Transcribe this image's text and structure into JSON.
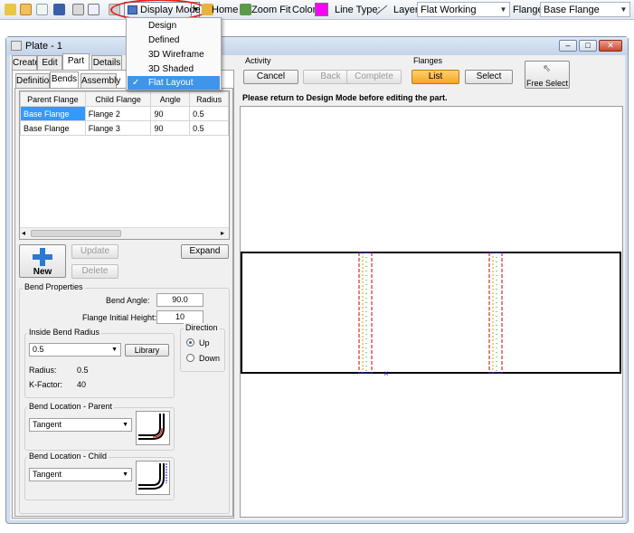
{
  "toolbar": {
    "display_mode_label": "Display Mode",
    "home_label": "Home",
    "zoom_fit_label": "Zoom Fit",
    "color_label": "Color:",
    "color_value": "#ff00ff",
    "line_type_label": "Line Type:",
    "layer_label": "Layer:",
    "layer_value": "Flat Working",
    "flange_label": "Flange:",
    "flange_value": "Base Flange"
  },
  "display_menu": {
    "items": [
      {
        "label": "Design"
      },
      {
        "label": "Defined"
      },
      {
        "label": "3D Wireframe"
      },
      {
        "label": "3D Shaded"
      },
      {
        "label": "Flat Layout",
        "checked": true
      }
    ]
  },
  "window": {
    "title": "Plate - 1",
    "tabs": [
      "Create",
      "Edit",
      "Part",
      "Details"
    ],
    "active_tab": "Part",
    "subtabs": [
      "Definition",
      "Bends",
      "Assembly"
    ],
    "active_subtab": "Bends"
  },
  "bends_table": {
    "headers": [
      "Parent Flange",
      "Child Flange",
      "Angle",
      "Radius"
    ],
    "rows": [
      [
        "Base Flange",
        "Flange 2",
        "90",
        "0.5"
      ],
      [
        "Base Flange",
        "Flange 3",
        "90",
        "0.5"
      ]
    ]
  },
  "buttons": {
    "new": "New",
    "update": "Update",
    "delete": "Delete",
    "expand": "Expand",
    "library": "Library"
  },
  "bend_properties": {
    "group_label": "Bend Properties",
    "bend_angle_label": "Bend Angle:",
    "bend_angle_value": "90.0",
    "flange_height_label": "Flange Initial Height:",
    "flange_height_value": "10",
    "inside_radius_label": "Inside Bend Radius",
    "inside_radius_value": "0.5",
    "radius_label": "Radius:",
    "radius_value": "0.5",
    "kfactor_label": "K-Factor:",
    "kfactor_value": "40",
    "direction_label": "Direction",
    "direction_up": "Up",
    "direction_down": "Down",
    "direction_selected": "Up",
    "location_parent_label": "Bend Location - Parent",
    "location_parent_value": "Tangent",
    "location_child_label": "Bend Location - Child",
    "location_child_value": "Tangent"
  },
  "activity": {
    "label": "Activity",
    "cancel": "Cancel",
    "back": "Back",
    "complete": "Complete"
  },
  "flanges": {
    "label": "Flanges",
    "list": "List",
    "select": "Select",
    "free_select": "Free Select"
  },
  "status_message": "Please return to Design Mode before editing the part."
}
